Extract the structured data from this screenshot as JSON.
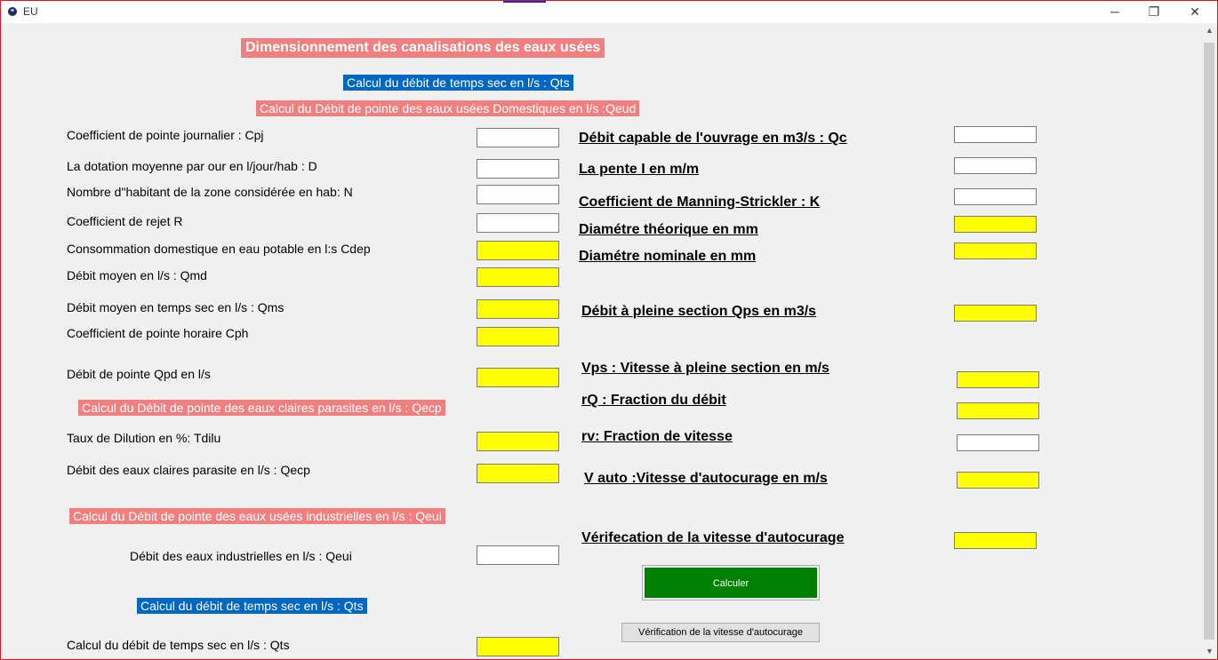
{
  "window": {
    "title": "EU",
    "minimize_glyph": "─",
    "restore_glyph": "❐",
    "close_glyph": "✕",
    "border_color": "#e81123"
  },
  "colors": {
    "pink_header": "#f08080",
    "blue_header": "#0067c0",
    "result_field": "#ffff00",
    "calc_button": "#008000"
  },
  "headers": {
    "main_title": "Dimensionnement des canalisations des eaux  usées",
    "qts_top": "Calcul du débit de temps sec en l/s :  Qts",
    "qeud": "Calcul du Débit  de pointe des eaux usées Domestiques en l/s :Qeud",
    "qecp": "Calcul du Débit  de pointe des eaux claires parasites  en l/s : Qecp",
    "qeui": "Calcul du Débit  de pointe des eaux usées industrielles en l/s : Qeui",
    "qts_bottom": "Calcul du débit de temps sec en l/s :  Qts"
  },
  "left_fields": [
    {
      "label": "Coefficient de pointe journalier : Cpj",
      "value": ""
    },
    {
      "label": "La dotation moyenne par our en l/jour/hab : D",
      "value": ""
    },
    {
      "label": "Nombre d\"habitant de la zone considérée en hab: N",
      "value": ""
    },
    {
      "label": "Coefficient de rejet R",
      "value": ""
    },
    {
      "label": "Consommation domestique en eau potable en l:s Cdep",
      "value": ""
    },
    {
      "label": "Débit moyen  en l/s : Qmd",
      "value": ""
    },
    {
      "label": "Débit moyen en temps sec   en l/s : Qms",
      "value": ""
    },
    {
      "label": "Coefficient de pointe horaire Cph",
      "value": ""
    },
    {
      "label": "Débit de pointe Qpd en l/s",
      "value": ""
    },
    {
      "label": "Taux de Dilution en %:  Tdilu",
      "value": ""
    },
    {
      "label": "Débit des eaux claires parasite en l/s : Qecp",
      "value": ""
    },
    {
      "label": "Débit des eaux  industrielles  en l/s : Qeui",
      "value": ""
    },
    {
      "label": "Calcul du débit de temps sec en l/s :  Qts",
      "value": ""
    }
  ],
  "right_fields": [
    {
      "label": "Débit  capable de l'ouvrage en m3/s : Qc",
      "value": ""
    },
    {
      "label": "La pente I en m/m",
      "value": ""
    },
    {
      "label": "Coefficient de Manning-Strickler : K",
      "value": ""
    },
    {
      "label": "Diamétre théorique en mm",
      "value": ""
    },
    {
      "label": "Diamétre nominale en mm",
      "value": ""
    },
    {
      "label": "Débit  à pleine section Qps en m3/s",
      "value": ""
    },
    {
      "label": "Vps : Vitesse à pleine section en m/s",
      "value": ""
    },
    {
      "label": "rQ : Fraction du débit",
      "value": ""
    },
    {
      "label": "rv: Fraction de vitesse",
      "value": ""
    },
    {
      "label": "V   auto :Vitesse d'autocurage en m/s",
      "value": ""
    },
    {
      "label": "Vérifecation de la vitesse d'autocurage",
      "value": ""
    }
  ],
  "buttons": {
    "calculer": "Calculer",
    "verification": "Vérification de la vitesse d'autocurage"
  }
}
